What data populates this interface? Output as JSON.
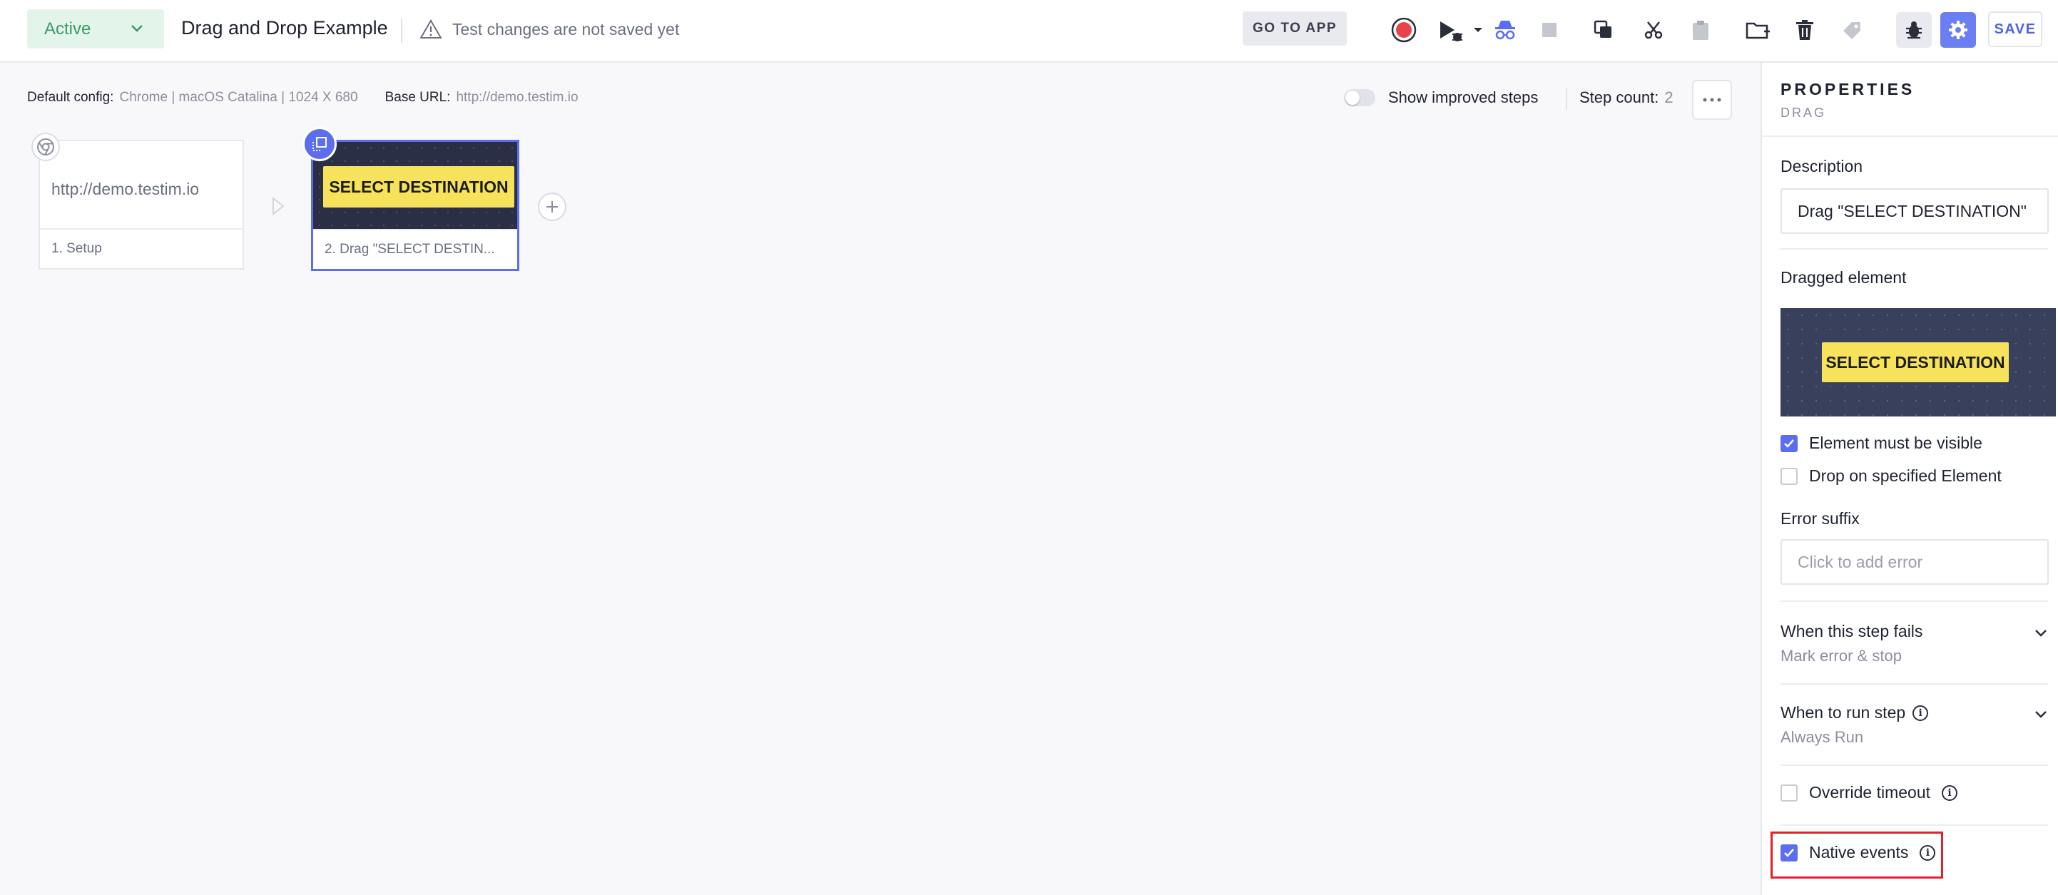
{
  "topbar": {
    "status": "Active",
    "test_title": "Drag and Drop Example",
    "warning": "Test changes are not saved yet",
    "goto_app": "GO TO APP",
    "save": "SAVE"
  },
  "canvas": {
    "default_config_label": "Default config:",
    "default_config_value": "Chrome | macOS Catalina | 1024 X 680",
    "base_url_label": "Base URL:",
    "base_url_value": "http://demo.testim.io",
    "show_improved_steps": "Show improved steps",
    "step_count_label": "Step count:",
    "step_count_value": "2",
    "steps": [
      {
        "thumb_text": "http://demo.testim.io",
        "label": "1. Setup"
      },
      {
        "thumb_text": "SELECT DESTINATION",
        "label": "2. Drag \"SELECT DESTIN..."
      }
    ]
  },
  "properties": {
    "title": "PROPERTIES",
    "subtitle": "DRAG",
    "description_label": "Description",
    "description_value": "Drag \"SELECT DESTINATION\"",
    "dragged_element_label": "Dragged element",
    "dragged_element_text": "SELECT DESTINATION",
    "element_visible": "Element must be visible",
    "drop_on_element": "Drop on specified Element",
    "error_suffix_label": "Error suffix",
    "error_suffix_placeholder": "Click to add error",
    "when_fails_title": "When this step fails",
    "when_fails_value": "Mark error & stop",
    "when_run_title": "When to run step",
    "when_run_value": "Always Run",
    "override_timeout": "Override timeout",
    "native_events": "Native events"
  },
  "colors": {
    "accent": "#5b6ef0",
    "status_bg": "#e3f4ea",
    "status_text": "#3c9a63",
    "record": "#e8434b",
    "highlight": "#e4202a",
    "chip": "#f6e35b"
  }
}
